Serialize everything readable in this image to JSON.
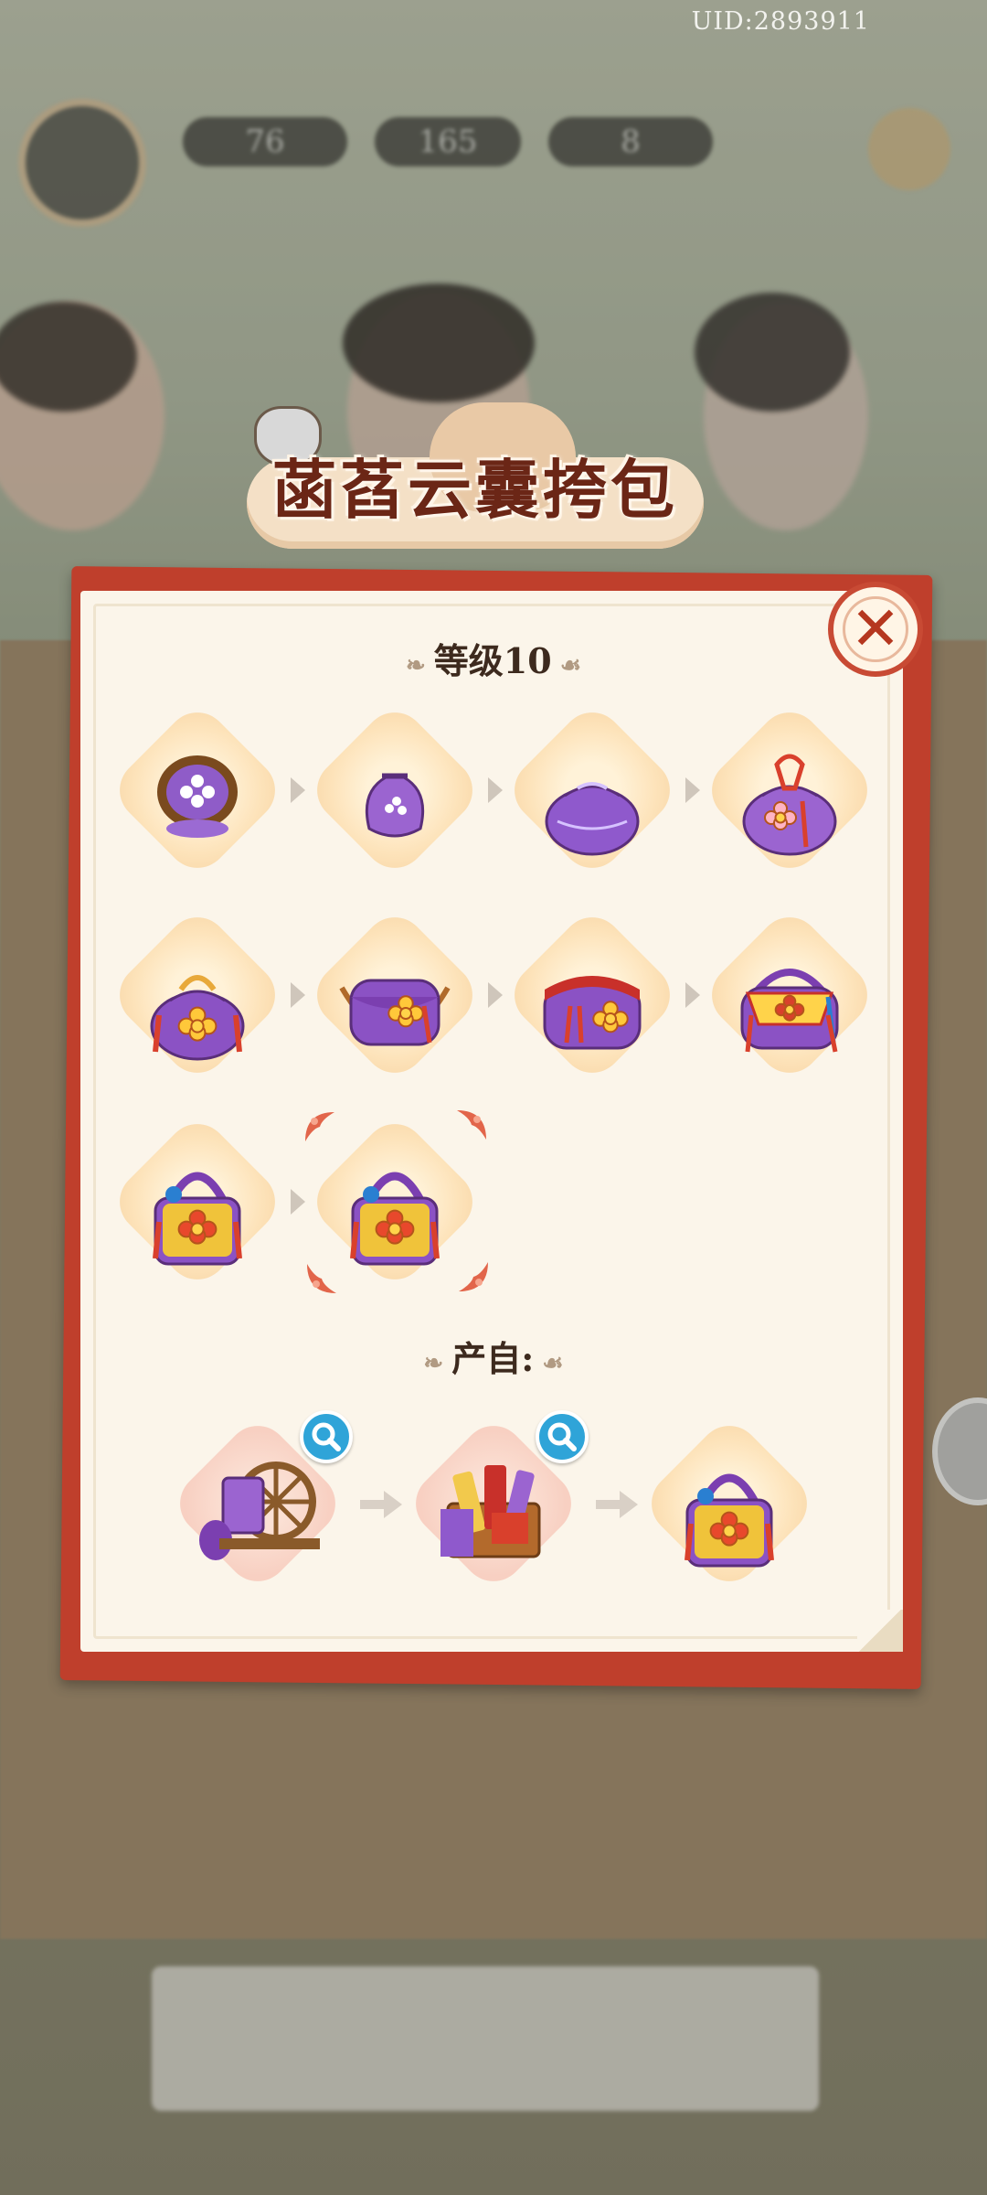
{
  "uid": "UID:2893911",
  "resources": {
    "energy": "76",
    "coins": "165",
    "gems": "8"
  },
  "title": "菡萏云囊挎包",
  "level_label": "等级10",
  "source_label": "产自:",
  "chain_rows": [
    [
      "embroidery-hoop",
      "small-purple-pouch",
      "purple-drawstring-pouch",
      "knotted-purple-pouch"
    ],
    [
      "lotus-pouch",
      "lotus-crossbody-bag",
      "red-lotus-bag",
      "tasseled-lotus-bag"
    ],
    [
      "floral-handbag",
      "lotus-cloud-crossbody-bag"
    ]
  ],
  "sources": [
    "spinning-wheel",
    "silk-supply-crate",
    "lotus-cloud-crossbody-bag"
  ],
  "colors": {
    "frame": "#bf3f2c",
    "paper": "#fbf5ea",
    "title_text": "#6b2616",
    "diamond": "#fde3ba",
    "purple": "#8b52c4"
  }
}
